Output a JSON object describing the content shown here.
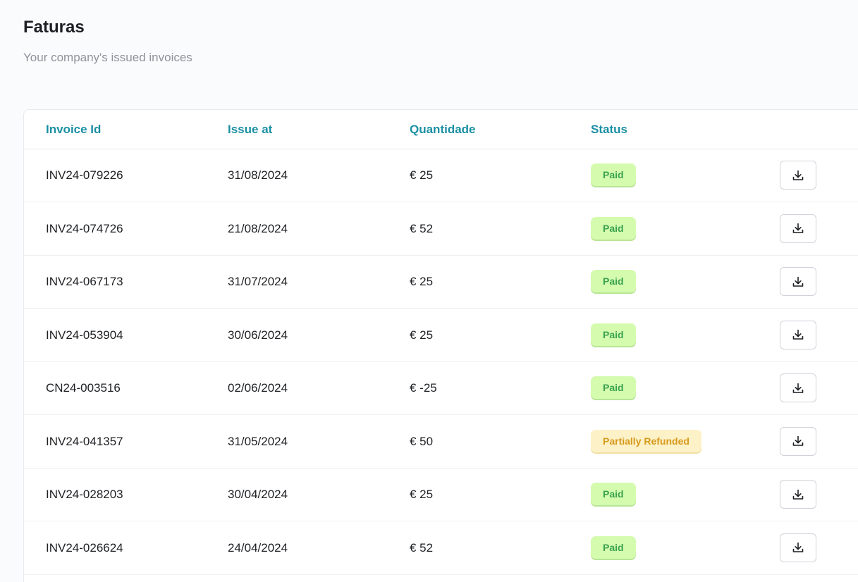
{
  "header": {
    "title": "Faturas",
    "subtitle": "Your company's issued invoices"
  },
  "table": {
    "columns": {
      "invoice_id": "Invoice Id",
      "issue_at": "Issue at",
      "amount": "Quantidade",
      "status": "Status"
    },
    "rows": [
      {
        "id": "INV24-079226",
        "date": "31/08/2024",
        "amount": "€ 25",
        "status": "Paid",
        "status_kind": "paid"
      },
      {
        "id": "INV24-074726",
        "date": "21/08/2024",
        "amount": "€ 52",
        "status": "Paid",
        "status_kind": "paid"
      },
      {
        "id": "INV24-067173",
        "date": "31/07/2024",
        "amount": "€ 25",
        "status": "Paid",
        "status_kind": "paid"
      },
      {
        "id": "INV24-053904",
        "date": "30/06/2024",
        "amount": "€ 25",
        "status": "Paid",
        "status_kind": "paid"
      },
      {
        "id": "CN24-003516",
        "date": "02/06/2024",
        "amount": "€ -25",
        "status": "Paid",
        "status_kind": "paid"
      },
      {
        "id": "INV24-041357",
        "date": "31/05/2024",
        "amount": "€ 50",
        "status": "Partially Refunded",
        "status_kind": "partial"
      },
      {
        "id": "INV24-028203",
        "date": "30/04/2024",
        "amount": "€ 25",
        "status": "Paid",
        "status_kind": "paid"
      },
      {
        "id": "INV24-026624",
        "date": "24/04/2024",
        "amount": "€ 52",
        "status": "Paid",
        "status_kind": "paid"
      }
    ],
    "row_action_icon": "download-icon"
  },
  "colors": {
    "accent": "#1a8fa3",
    "paid_bg": "#d4fbae",
    "paid_text": "#3aa34f",
    "partial_bg": "#fdf1c7",
    "partial_text": "#d79a1d"
  }
}
